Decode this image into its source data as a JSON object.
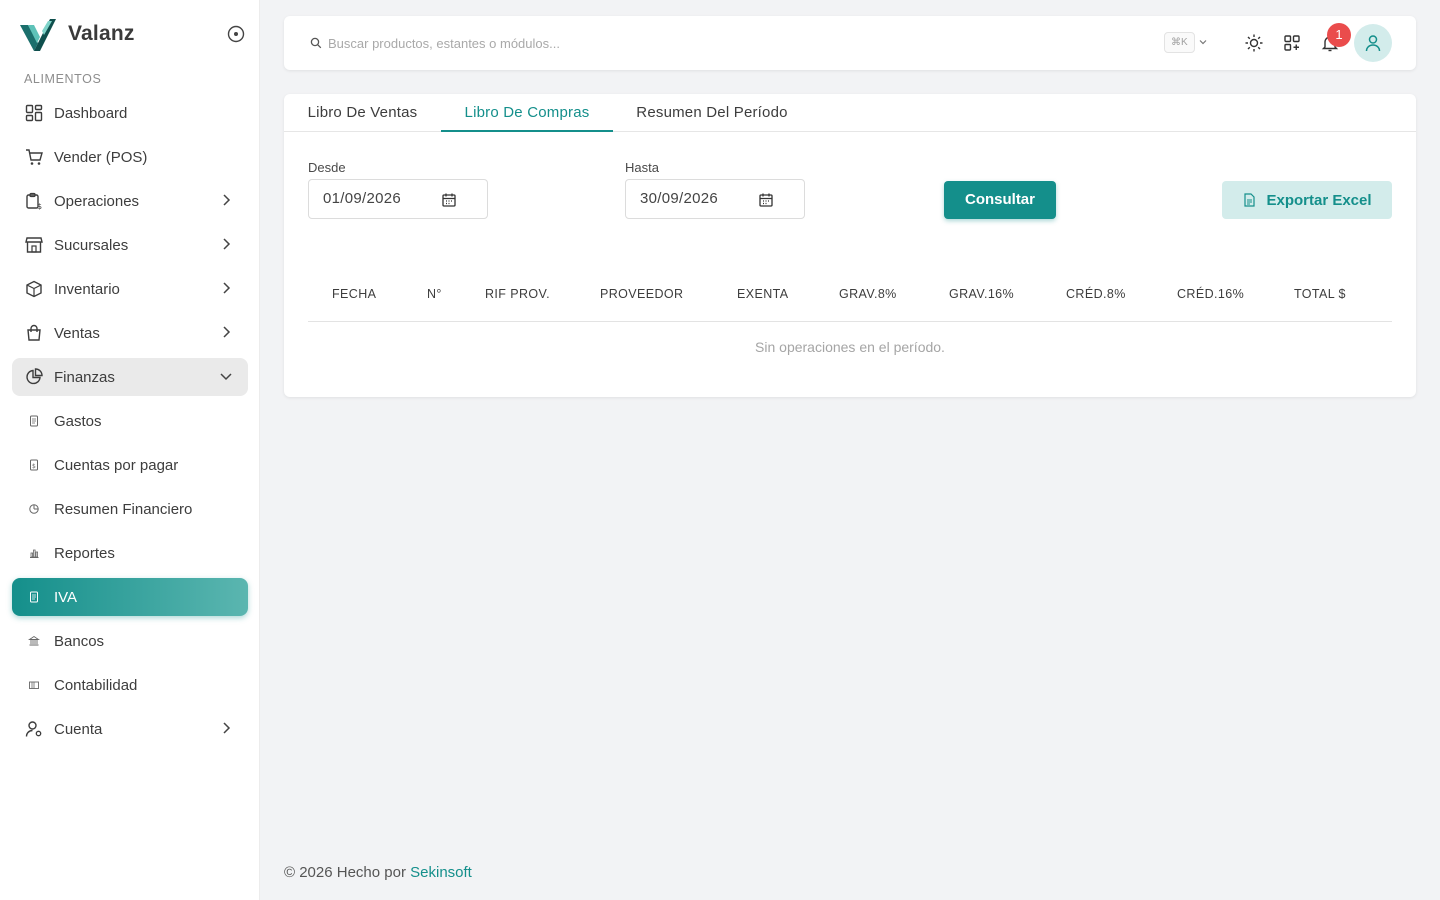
{
  "brand": {
    "name": "Valanz"
  },
  "sidebar": {
    "section": "ALIMENTOS",
    "items": [
      {
        "label": "Dashboard"
      },
      {
        "label": "Vender (POS)"
      },
      {
        "label": "Operaciones"
      },
      {
        "label": "Sucursales"
      },
      {
        "label": "Inventario"
      },
      {
        "label": "Ventas"
      },
      {
        "label": "Finanzas"
      },
      {
        "label": "Gastos"
      },
      {
        "label": "Cuentas por pagar"
      },
      {
        "label": "Resumen Financiero"
      },
      {
        "label": "Reportes"
      },
      {
        "label": "IVA"
      },
      {
        "label": "Bancos"
      },
      {
        "label": "Contabilidad"
      },
      {
        "label": "Cuenta"
      }
    ]
  },
  "topbar": {
    "search_placeholder": "Buscar productos, estantes o módulos...",
    "shortcut": "⌘K",
    "notification_count": "1"
  },
  "tabs": [
    {
      "label": "Libro De Ventas"
    },
    {
      "label": "Libro De Compras"
    },
    {
      "label": "Resumen Del Período"
    }
  ],
  "filters": {
    "from_label": "Desde",
    "from_value": "01/09/2026",
    "to_label": "Hasta",
    "to_value": "30/09/2026",
    "submit_label": "Consultar",
    "export_label": "Exportar Excel"
  },
  "table": {
    "columns": [
      "FECHA",
      "N°",
      "RIF PROV.",
      "PROVEEDOR",
      "EXENTA",
      "GRAV.8%",
      "GRAV.16%",
      "CRÉD.8%",
      "CRÉD.16%",
      "TOTAL $"
    ],
    "empty_text": "Sin operaciones en el período."
  },
  "footer": {
    "prefix": "© 2026 Hecho por",
    "link": "Sekinsoft"
  },
  "colors": {
    "accent": "#148f8b",
    "accent_light": "#d3eceb",
    "badge": "#ea4c4c"
  }
}
